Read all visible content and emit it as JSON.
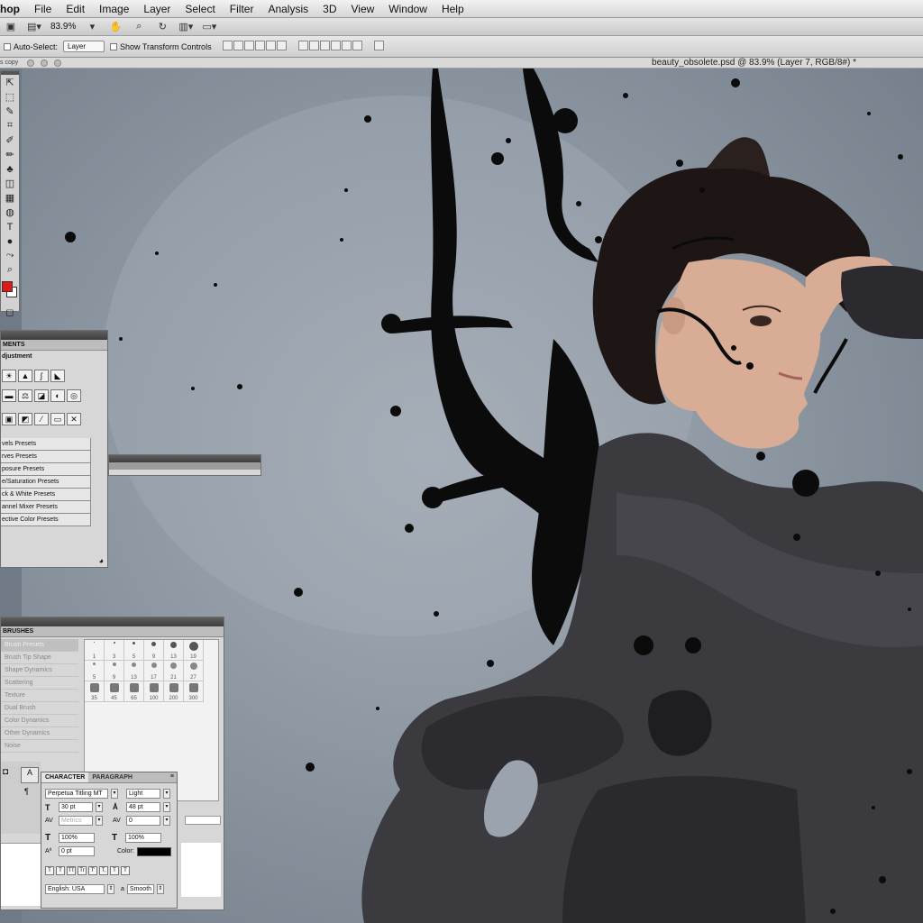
{
  "menubar": {
    "app_name": "hop",
    "items": [
      "File",
      "Edit",
      "Image",
      "Layer",
      "Select",
      "Filter",
      "Analysis",
      "3D",
      "View",
      "Window",
      "Help"
    ]
  },
  "appbar": {
    "zoom": "83.9%"
  },
  "options": {
    "auto_select_label": "Auto-Select:",
    "auto_select_value": "Layer",
    "transform_label": "Show Transform Controls"
  },
  "document": {
    "title": "beauty_obsolete.psd @ 83.9% (Layer 7, RGB/8#) *",
    "left_fragment": "s copy"
  },
  "tools": {
    "icons": [
      "move-icon",
      "marquee-icon",
      "lasso-icon",
      "crop-icon",
      "eyedropper-icon",
      "brush-icon",
      "stamp-icon",
      "eraser-icon",
      "gradient-icon",
      "dodge-icon",
      "type-icon",
      "shape-icon",
      "path-icon",
      "zoom-icon"
    ],
    "glyphs": [
      "⇱",
      "⬚",
      "✎",
      "⌗",
      "✐",
      "✏",
      "♣",
      "◫",
      "▦",
      "◍",
      "T",
      "●",
      "⤳",
      "⌕"
    ],
    "foreground_color": "#e11818",
    "background_color": "#ffffff"
  },
  "adjustments": {
    "tab": "MENTS",
    "subtitle": "djustment",
    "row1": [
      "☀",
      "▲",
      "∫",
      "◣"
    ],
    "row2": [
      "▬",
      "⚖",
      "◪",
      "◐",
      "◎"
    ],
    "row3": [
      "▣",
      "◩",
      "⁄",
      "▭",
      "✕"
    ],
    "presets": [
      "vels Presets",
      "rves Presets",
      "posure Presets",
      "e/Saturation Presets",
      "ck & White Presets",
      "annel Mixer Presets",
      "ective Color Presets"
    ]
  },
  "brushes": {
    "tab": "BRUSHES",
    "left_items": [
      {
        "label": "Brush Presets",
        "active": true
      },
      {
        "label": "Brush Tip Shape",
        "active": false
      },
      {
        "label": "Shape Dynamics",
        "active": false
      },
      {
        "label": "Scattering",
        "active": false
      },
      {
        "label": "Texture",
        "active": false
      },
      {
        "label": "Dual Brush",
        "active": false
      },
      {
        "label": "Color Dynamics",
        "active": false
      },
      {
        "label": "Other Dynamics",
        "active": false
      },
      {
        "label": "Noise",
        "active": false
      }
    ],
    "tips": [
      "1",
      "3",
      "5",
      "9",
      "13",
      "19",
      "5",
      "9",
      "13",
      "17",
      "21",
      "27",
      "35",
      "45",
      "65",
      "100",
      "200",
      "300"
    ],
    "tip_sizes": [
      "1",
      "3",
      "5",
      "9",
      "13",
      "19",
      "5",
      "9",
      "13",
      "17",
      "21",
      "27",
      "35",
      "45",
      "65",
      "100",
      "200",
      "300"
    ]
  },
  "character": {
    "tab_character": "CHARACTER",
    "tab_paragraph": "PARAGRAPH",
    "font_family": "Perpetua Titling MT",
    "font_style": "Light",
    "font_size": "30 pt",
    "leading": "48 pt",
    "kerning": "Metrics",
    "tracking": "0",
    "vertical_scale": "100%",
    "horizontal_scale": "100%",
    "baseline_shift": "0 pt",
    "color_label": "Color:",
    "language": "English: USA",
    "aa_label": "a",
    "antialias": "Smooth",
    "style_buttons": [
      "T",
      "T",
      "TT",
      "Tr",
      "T'",
      "T,",
      "T",
      "T"
    ]
  },
  "colors": {
    "panel_bg": "#d7d7d7",
    "panel_header": "#4a4a4a",
    "ink": "#0b0b0c",
    "canvas_bg": "#8e98a3"
  }
}
